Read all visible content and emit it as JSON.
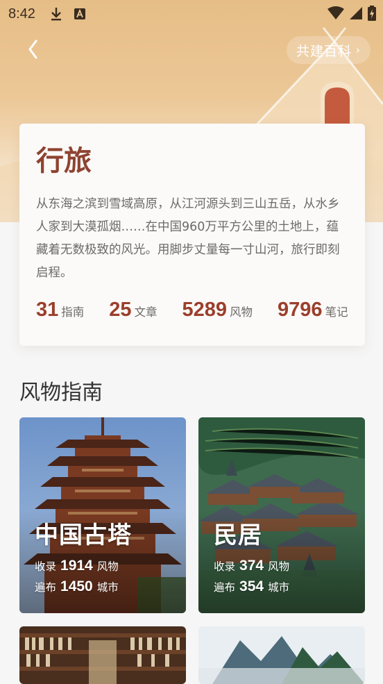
{
  "status_bar": {
    "time": "8:42",
    "icons": [
      "download-icon",
      "font-a-icon",
      "wifi-icon",
      "cell-signal-icon",
      "battery-charging-icon"
    ]
  },
  "header": {
    "back_icon": "chevron-left-icon",
    "wiki_button": "共建百科",
    "wiki_chevron": "›"
  },
  "intro": {
    "title": "行旅",
    "description": "从东海之滨到雪域高原，从江河源头到三山五岳，从水乡人家到大漠孤烟……在中国960万平方公里的土地上，蕴藏着无数极致的风光。用脚步丈量每一寸山河，旅行即刻启程。",
    "stats": [
      {
        "value": "31",
        "label": "指南"
      },
      {
        "value": "25",
        "label": "文章"
      },
      {
        "value": "5289",
        "label": "风物"
      },
      {
        "value": "9796",
        "label": "笔记"
      }
    ]
  },
  "section": {
    "title": "风物指南"
  },
  "guides": [
    {
      "name": "中国古塔",
      "collected_prefix": "收录",
      "collected": "1914",
      "collected_unit": "风物",
      "spread_prefix": "遍布",
      "spread": "1450",
      "spread_unit": "城市"
    },
    {
      "name": "民居",
      "collected_prefix": "收录",
      "collected": "374",
      "collected_unit": "风物",
      "spread_prefix": "遍布",
      "spread": "354",
      "spread_unit": "城市"
    }
  ],
  "colors": {
    "accent": "#9b3f2c",
    "title": "#8e4331",
    "hero": "#e6bd86"
  }
}
